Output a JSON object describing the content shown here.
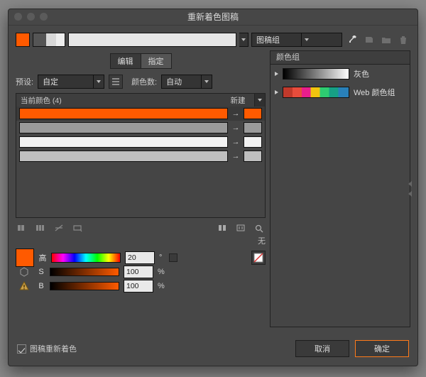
{
  "window": {
    "title": "重新着色图稿"
  },
  "top": {
    "group_select_label": "图稿组"
  },
  "tabs": {
    "edit": "编辑",
    "assign": "指定"
  },
  "preset": {
    "label": "预设:",
    "value": "自定",
    "colors_label": "颜色数:",
    "colors_value": "自动"
  },
  "list": {
    "header_current": "当前颜色 (4)",
    "header_new": "新建",
    "rows": [
      {
        "bar_color": "#ff5a00",
        "chip_color": "#ff5a00",
        "selected": true
      },
      {
        "bar_color": "#9a9a9a",
        "chip_color": "#9a9a9a",
        "selected": false
      },
      {
        "bar_color": "#f2f2f2",
        "chip_color": "#f2f2f2",
        "selected": false
      },
      {
        "bar_color": "#bfbfbf",
        "chip_color": "#bfbfbf",
        "selected": false
      }
    ]
  },
  "none_label": "无",
  "hsb": {
    "h_label": "高",
    "h_value": "20",
    "h_unit": "°",
    "s_label": "S",
    "s_value": "100",
    "s_unit": "%",
    "b_label": "B",
    "b_value": "100",
    "b_unit": "%",
    "swatch": "#ff5a00"
  },
  "right": {
    "header": "颜色组",
    "groups": [
      {
        "key": "grayscale",
        "label": "灰色"
      },
      {
        "key": "webcols",
        "label": "Web 颜色组"
      }
    ]
  },
  "footer": {
    "checkbox_label": "图稿重新着色",
    "cancel": "取消",
    "ok": "确定"
  }
}
